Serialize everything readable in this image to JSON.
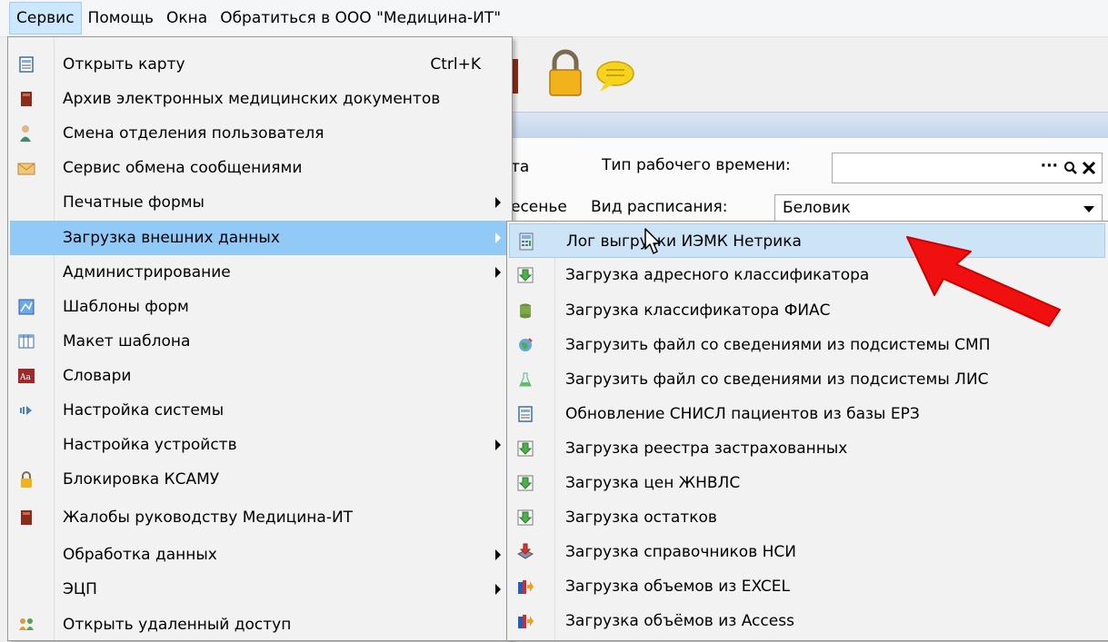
{
  "menubar": {
    "items": [
      "Сервис",
      "Помощь",
      "Окна",
      "Обратиться в ООО \"Медицина-ИТ\""
    ]
  },
  "background": {
    "left_label_fragment": "та",
    "work_time_label": "Тип рабочего времени:",
    "left_label_fragment2": "есенье",
    "schedule_label": "Вид расписания:",
    "schedule_value": "Беловик",
    "dots": "···"
  },
  "service_menu": {
    "items": [
      {
        "label": "Открыть карту",
        "shortcut": "Ctrl+K",
        "icon": "open-card-icon"
      },
      {
        "label": "Архив электронных медицинских документов",
        "icon": "archive-book-icon"
      },
      {
        "label": "Смена отделения пользователя",
        "icon": "user-change-icon"
      },
      {
        "label": "Сервис обмена сообщениями",
        "icon": "envelope-icon"
      },
      {
        "label": "Печатные формы",
        "submenu": true
      },
      {
        "label": "Загрузка внешних данных",
        "submenu": true
      },
      {
        "label": "Администрирование",
        "submenu": true
      },
      {
        "label": "Шаблоны форм",
        "icon": "form-templates-icon"
      },
      {
        "label": "Макет шаблона",
        "icon": "grid-layout-icon"
      },
      {
        "label": "Словари",
        "icon": "dictionary-icon"
      },
      {
        "label": "Настройка системы",
        "icon": "system-settings-icon"
      },
      {
        "label": "Настройка устройств",
        "submenu": true
      },
      {
        "label": "Блокировка КСАМУ",
        "icon": "lock-icon"
      },
      {
        "label": "Жалобы руководству Медицина-ИТ",
        "icon": "book-icon"
      },
      {
        "label": "Обработка данных",
        "submenu": true
      },
      {
        "label": "ЭЦП",
        "submenu": true
      },
      {
        "label": "Открыть удаленный доступ",
        "icon": "remote-access-icon"
      }
    ]
  },
  "external_data_menu": {
    "items": [
      {
        "label": "Лог выгрузки ИЭМК Нетрика",
        "icon": "calculator-icon"
      },
      {
        "label": "Загрузка адресного классификатора",
        "icon": "download-green-icon"
      },
      {
        "label": "Загрузка классификатора ФИАС",
        "icon": "database-icon"
      },
      {
        "label": "Загрузить файл со сведениями из подсистемы СМП",
        "icon": "globe-icon"
      },
      {
        "label": "Загрузить файл со сведениями из подсистемы ЛИС",
        "icon": "flask-icon"
      },
      {
        "label": "Обновление СНИСЛ пациентов из базы ЕРЗ",
        "icon": "document-icon"
      },
      {
        "label": "Загрузка реестра застрахованных",
        "icon": "download-green-icon"
      },
      {
        "label": "Загрузка цен ЖНВЛС",
        "icon": "download-green-icon"
      },
      {
        "label": "Загрузка остатков",
        "icon": "download-green-icon"
      },
      {
        "label": "Загрузка справочников НСИ",
        "icon": "download-tray-icon"
      },
      {
        "label": "Загрузка объемов из EXCEL",
        "icon": "excel-import-icon"
      },
      {
        "label": "Загрузка объёмов из Access",
        "icon": "access-import-icon"
      }
    ]
  }
}
